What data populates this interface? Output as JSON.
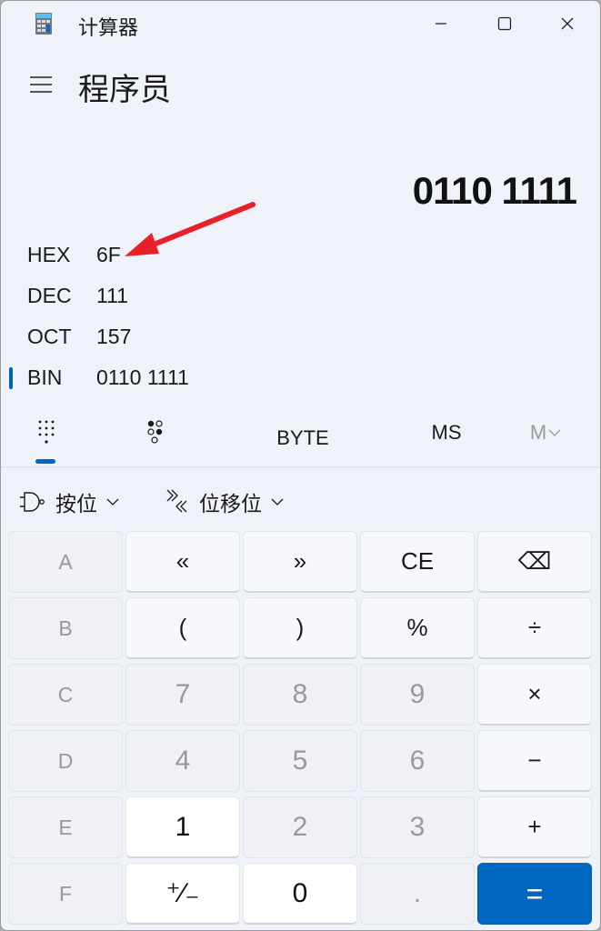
{
  "window": {
    "title": "计算器",
    "icons": {
      "app": "calculator-icon",
      "minimize": "minimize-icon",
      "maximize": "maximize-icon",
      "close": "close-icon"
    }
  },
  "header": {
    "menu_icon": "hamburger-menu-icon",
    "mode": "程序员"
  },
  "display": {
    "value": "0110 1111"
  },
  "radix": [
    {
      "label": "HEX",
      "value": "6F",
      "selected": false
    },
    {
      "label": "DEC",
      "value": "111",
      "selected": false
    },
    {
      "label": "OCT",
      "value": "157",
      "selected": false
    },
    {
      "label": "BIN",
      "value": "0110 1111",
      "selected": true
    }
  ],
  "annotation": {
    "type": "red-arrow",
    "points_to": "HEX value",
    "color": "#e8202a"
  },
  "tabs": [
    {
      "name": "full-keypad",
      "icon": "full-keypad-icon",
      "active": true
    },
    {
      "name": "bit-toggling-keypad",
      "icon": "bit-toggle-keypad-icon",
      "active": false
    },
    {
      "name": "word-size",
      "label": "BYTE"
    },
    {
      "name": "memory-store",
      "label": "MS"
    },
    {
      "name": "memory-list",
      "label": "M",
      "disabled": true
    }
  ],
  "dropdowns": [
    {
      "label": "按位",
      "icon": "bitwise-gate-icon"
    },
    {
      "label": "位移位",
      "icon": "bit-shift-icon"
    }
  ],
  "keypad": [
    [
      {
        "label": "A",
        "type": "disabled letter"
      },
      {
        "label": "«",
        "type": "op",
        "name": "left-shift"
      },
      {
        "label": "»",
        "type": "op",
        "name": "right-shift"
      },
      {
        "label": "CE",
        "type": "op",
        "name": "clear-entry"
      },
      {
        "label": "⌫",
        "type": "op",
        "name": "backspace"
      }
    ],
    [
      {
        "label": "B",
        "type": "disabled letter"
      },
      {
        "label": "(",
        "type": "op",
        "name": "open-paren"
      },
      {
        "label": ")",
        "type": "op",
        "name": "close-paren"
      },
      {
        "label": "%",
        "type": "op",
        "name": "modulo"
      },
      {
        "label": "÷",
        "type": "op",
        "name": "divide"
      }
    ],
    [
      {
        "label": "C",
        "type": "disabled letter"
      },
      {
        "label": "7",
        "type": "numdis"
      },
      {
        "label": "8",
        "type": "numdis"
      },
      {
        "label": "9",
        "type": "numdis"
      },
      {
        "label": "×",
        "type": "op",
        "name": "multiply"
      }
    ],
    [
      {
        "label": "D",
        "type": "disabled letter"
      },
      {
        "label": "4",
        "type": "numdis"
      },
      {
        "label": "5",
        "type": "numdis"
      },
      {
        "label": "6",
        "type": "numdis"
      },
      {
        "label": "−",
        "type": "op",
        "name": "subtract"
      }
    ],
    [
      {
        "label": "E",
        "type": "disabled letter"
      },
      {
        "label": "1",
        "type": "num"
      },
      {
        "label": "2",
        "type": "numdis"
      },
      {
        "label": "3",
        "type": "numdis"
      },
      {
        "label": "+",
        "type": "op",
        "name": "add"
      }
    ],
    [
      {
        "label": "F",
        "type": "disabled letter"
      },
      {
        "label": "⁺∕₋",
        "type": "num",
        "name": "negate"
      },
      {
        "label": "0",
        "type": "num"
      },
      {
        "label": ".",
        "type": "numdis",
        "name": "decimal"
      },
      {
        "label": "=",
        "type": "eq",
        "name": "equals"
      }
    ]
  ],
  "colors": {
    "accent": "#0067c0",
    "background": "#eff2f9",
    "disabled_text": "#999999"
  }
}
